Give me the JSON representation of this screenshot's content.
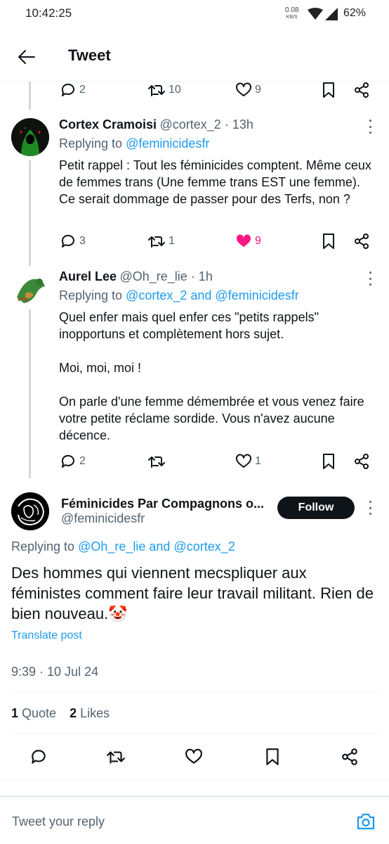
{
  "status_bar": {
    "time": "10:42:25",
    "net_speed": "0.08",
    "net_unit": "KB/S",
    "battery": "62%"
  },
  "header": {
    "title": "Tweet",
    "back_icon": "arrow-left-icon"
  },
  "top_action_bar": {
    "replies": "2",
    "retweets": "10",
    "likes": "9"
  },
  "replies": [
    {
      "name": "Cortex Cramoisi",
      "handle": "@cortex_2",
      "time": " · 13h",
      "replying_label": "Replying to ",
      "replying_to": "@feminicidesfr",
      "text": "Petit rappel : Tout les féminicides comptent. Même ceux de femmes trans (Une femme trans EST une femme). Ce serait dommage de passer pour des Terfs, non ?",
      "replies": "3",
      "retweets": "1",
      "likes": "9",
      "liked": true
    },
    {
      "name": "Aurel Lee",
      "handle": "@Oh_re_lie",
      "time": " · 1h",
      "replying_label": "Replying to ",
      "replying_to": "@cortex_2 and @feminicidesfr",
      "text": "Quel enfer mais quel enfer ces \"petits rappels\" inopportuns et complètement hors sujet.\n\nMoi, moi, moi !\n\nOn parle d'une femme démembrée et vous venez faire votre petite réclame sordide. Vous n'avez aucune décence.",
      "replies": "2",
      "retweets": "",
      "likes": "1",
      "liked": false
    }
  ],
  "main_tweet": {
    "name": "Féminicides Par Compagnons o...",
    "handle": "@feminicidesfr",
    "follow_label": "Follow",
    "replying_label": "Replying to ",
    "replying_to": "@Oh_re_lie and @cortex_2",
    "text": "Des hommes qui viennent mecspliquer aux féministes comment faire leur travail militant. Rien de bien nouveau.🤡",
    "translate_label": "Translate post",
    "timestamp": "9:39 · 10 Jul 24",
    "quote_count": "1",
    "quote_label": "Quote",
    "likes_count": "2",
    "likes_label": "Likes"
  },
  "reply_box": {
    "placeholder": "Tweet your reply",
    "camera_icon": "camera-icon"
  },
  "colors": {
    "accent": "#1d9bf0",
    "like": "#f91880",
    "text": "#0f1419",
    "muted": "#536471"
  }
}
